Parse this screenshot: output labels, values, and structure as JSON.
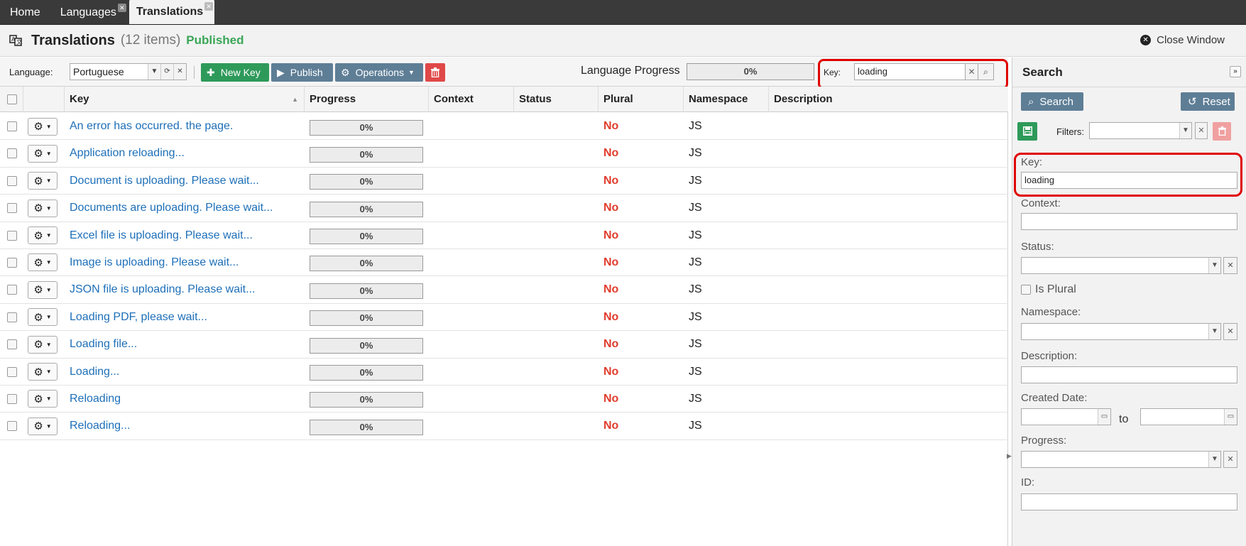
{
  "tabs": [
    {
      "label": "Home",
      "closable": false
    },
    {
      "label": "Languages",
      "closable": true
    },
    {
      "label": "Translations",
      "closable": true,
      "active": true
    }
  ],
  "header": {
    "title": "Translations",
    "count": "(12 items)",
    "status": "Published",
    "close_window": "Close Window"
  },
  "toolbar": {
    "language_label": "Language:",
    "language_value": "Portuguese",
    "new_key": "New Key",
    "publish": "Publish",
    "operations": "Operations",
    "language_progress_label": "Language Progress",
    "language_progress": "0%",
    "key_label": "Key:",
    "key_value": "loading"
  },
  "grid": {
    "columns": [
      "Key",
      "Progress",
      "Context",
      "Status",
      "Plural",
      "Namespace",
      "Description"
    ],
    "rows": [
      {
        "key": "An error has occurred. the page.",
        "progress": "0%",
        "context": "",
        "status": "",
        "plural": "No",
        "namespace": "JS",
        "description": ""
      },
      {
        "key": "Application reloading...",
        "progress": "0%",
        "context": "",
        "status": "",
        "plural": "No",
        "namespace": "JS",
        "description": ""
      },
      {
        "key": "Document is uploading. Please wait...",
        "progress": "0%",
        "context": "",
        "status": "",
        "plural": "No",
        "namespace": "JS",
        "description": ""
      },
      {
        "key": "Documents are uploading. Please wait...",
        "progress": "0%",
        "context": "",
        "status": "",
        "plural": "No",
        "namespace": "JS",
        "description": ""
      },
      {
        "key": "Excel file is uploading. Please wait...",
        "progress": "0%",
        "context": "",
        "status": "",
        "plural": "No",
        "namespace": "JS",
        "description": ""
      },
      {
        "key": "Image is uploading. Please wait...",
        "progress": "0%",
        "context": "",
        "status": "",
        "plural": "No",
        "namespace": "JS",
        "description": ""
      },
      {
        "key": "JSON file is uploading. Please wait...",
        "progress": "0%",
        "context": "",
        "status": "",
        "plural": "No",
        "namespace": "JS",
        "description": ""
      },
      {
        "key": "Loading PDF, please wait...",
        "progress": "0%",
        "context": "",
        "status": "",
        "plural": "No",
        "namespace": "JS",
        "description": ""
      },
      {
        "key": "Loading file...",
        "progress": "0%",
        "context": "",
        "status": "",
        "plural": "No",
        "namespace": "JS",
        "description": ""
      },
      {
        "key": "Loading...",
        "progress": "0%",
        "context": "",
        "status": "",
        "plural": "No",
        "namespace": "JS",
        "description": ""
      },
      {
        "key": "Reloading",
        "progress": "0%",
        "context": "",
        "status": "",
        "plural": "No",
        "namespace": "JS",
        "description": ""
      },
      {
        "key": "Reloading...",
        "progress": "0%",
        "context": "",
        "status": "",
        "plural": "No",
        "namespace": "JS",
        "description": ""
      }
    ]
  },
  "search_panel": {
    "title": "Search",
    "search_button": "Search",
    "reset_button": "Reset",
    "filters_label": "Filters:",
    "key_label": "Key:",
    "key_value": "loading",
    "context_label": "Context:",
    "status_label": "Status:",
    "is_plural_label": "Is Plural",
    "namespace_label": "Namespace:",
    "description_label": "Description:",
    "created_date_label": "Created Date:",
    "to_label": "to",
    "progress_label": "Progress:",
    "id_label": "ID:"
  },
  "colors": {
    "accent_green": "#2e9a5a",
    "button_slate": "#5e7e96",
    "danger_red": "#e04848",
    "link_blue": "#1d6fb8",
    "plural_no_red": "#e03c2c",
    "published_green": "#3aa657",
    "highlight_red": "#e00000"
  },
  "icons": {
    "title": "translate-icon",
    "close_window": "close-circle-icon",
    "new_key": "plus-icon",
    "publish": "play-icon",
    "operations": "gears-icon",
    "delete": "trash-icon",
    "refresh": "refresh-icon",
    "search": "magnifier-icon",
    "reset": "undo-icon",
    "save": "floppy-icon",
    "row_actions": "gear-icon"
  }
}
